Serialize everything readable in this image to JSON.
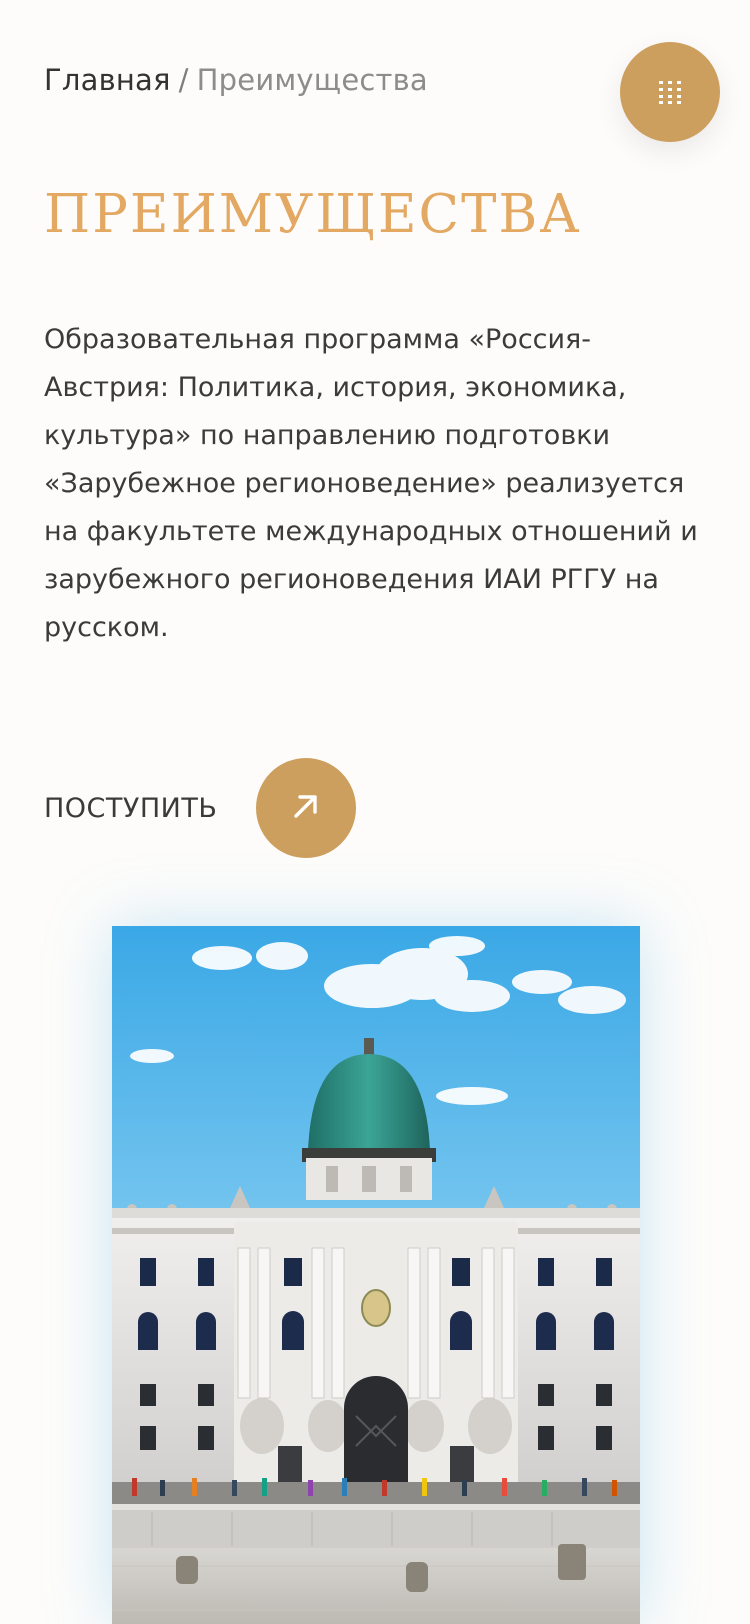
{
  "breadcrumb": {
    "home": "Главная",
    "separator": "/",
    "current": "Преимущества"
  },
  "menu": {
    "icon": "grid-menu-icon"
  },
  "page": {
    "title": "ПРЕИМУЩЕСТВА",
    "intro": "Образовательная программа «Россия-Австрия: Политика, история, экономика, культура» по направлению подготовки «Зарубежное регионоведение» реализуется на факультете международных отношений и зарубежного регионоведения ИАИ РГГУ на русском."
  },
  "cta": {
    "label": "ПОСТУПИТЬ",
    "icon": "arrow-up-right-icon"
  },
  "colors": {
    "accent": "#cd9f5e",
    "title": "#e3a862",
    "text": "#3b3b3b",
    "muted": "#8c8c8c"
  }
}
